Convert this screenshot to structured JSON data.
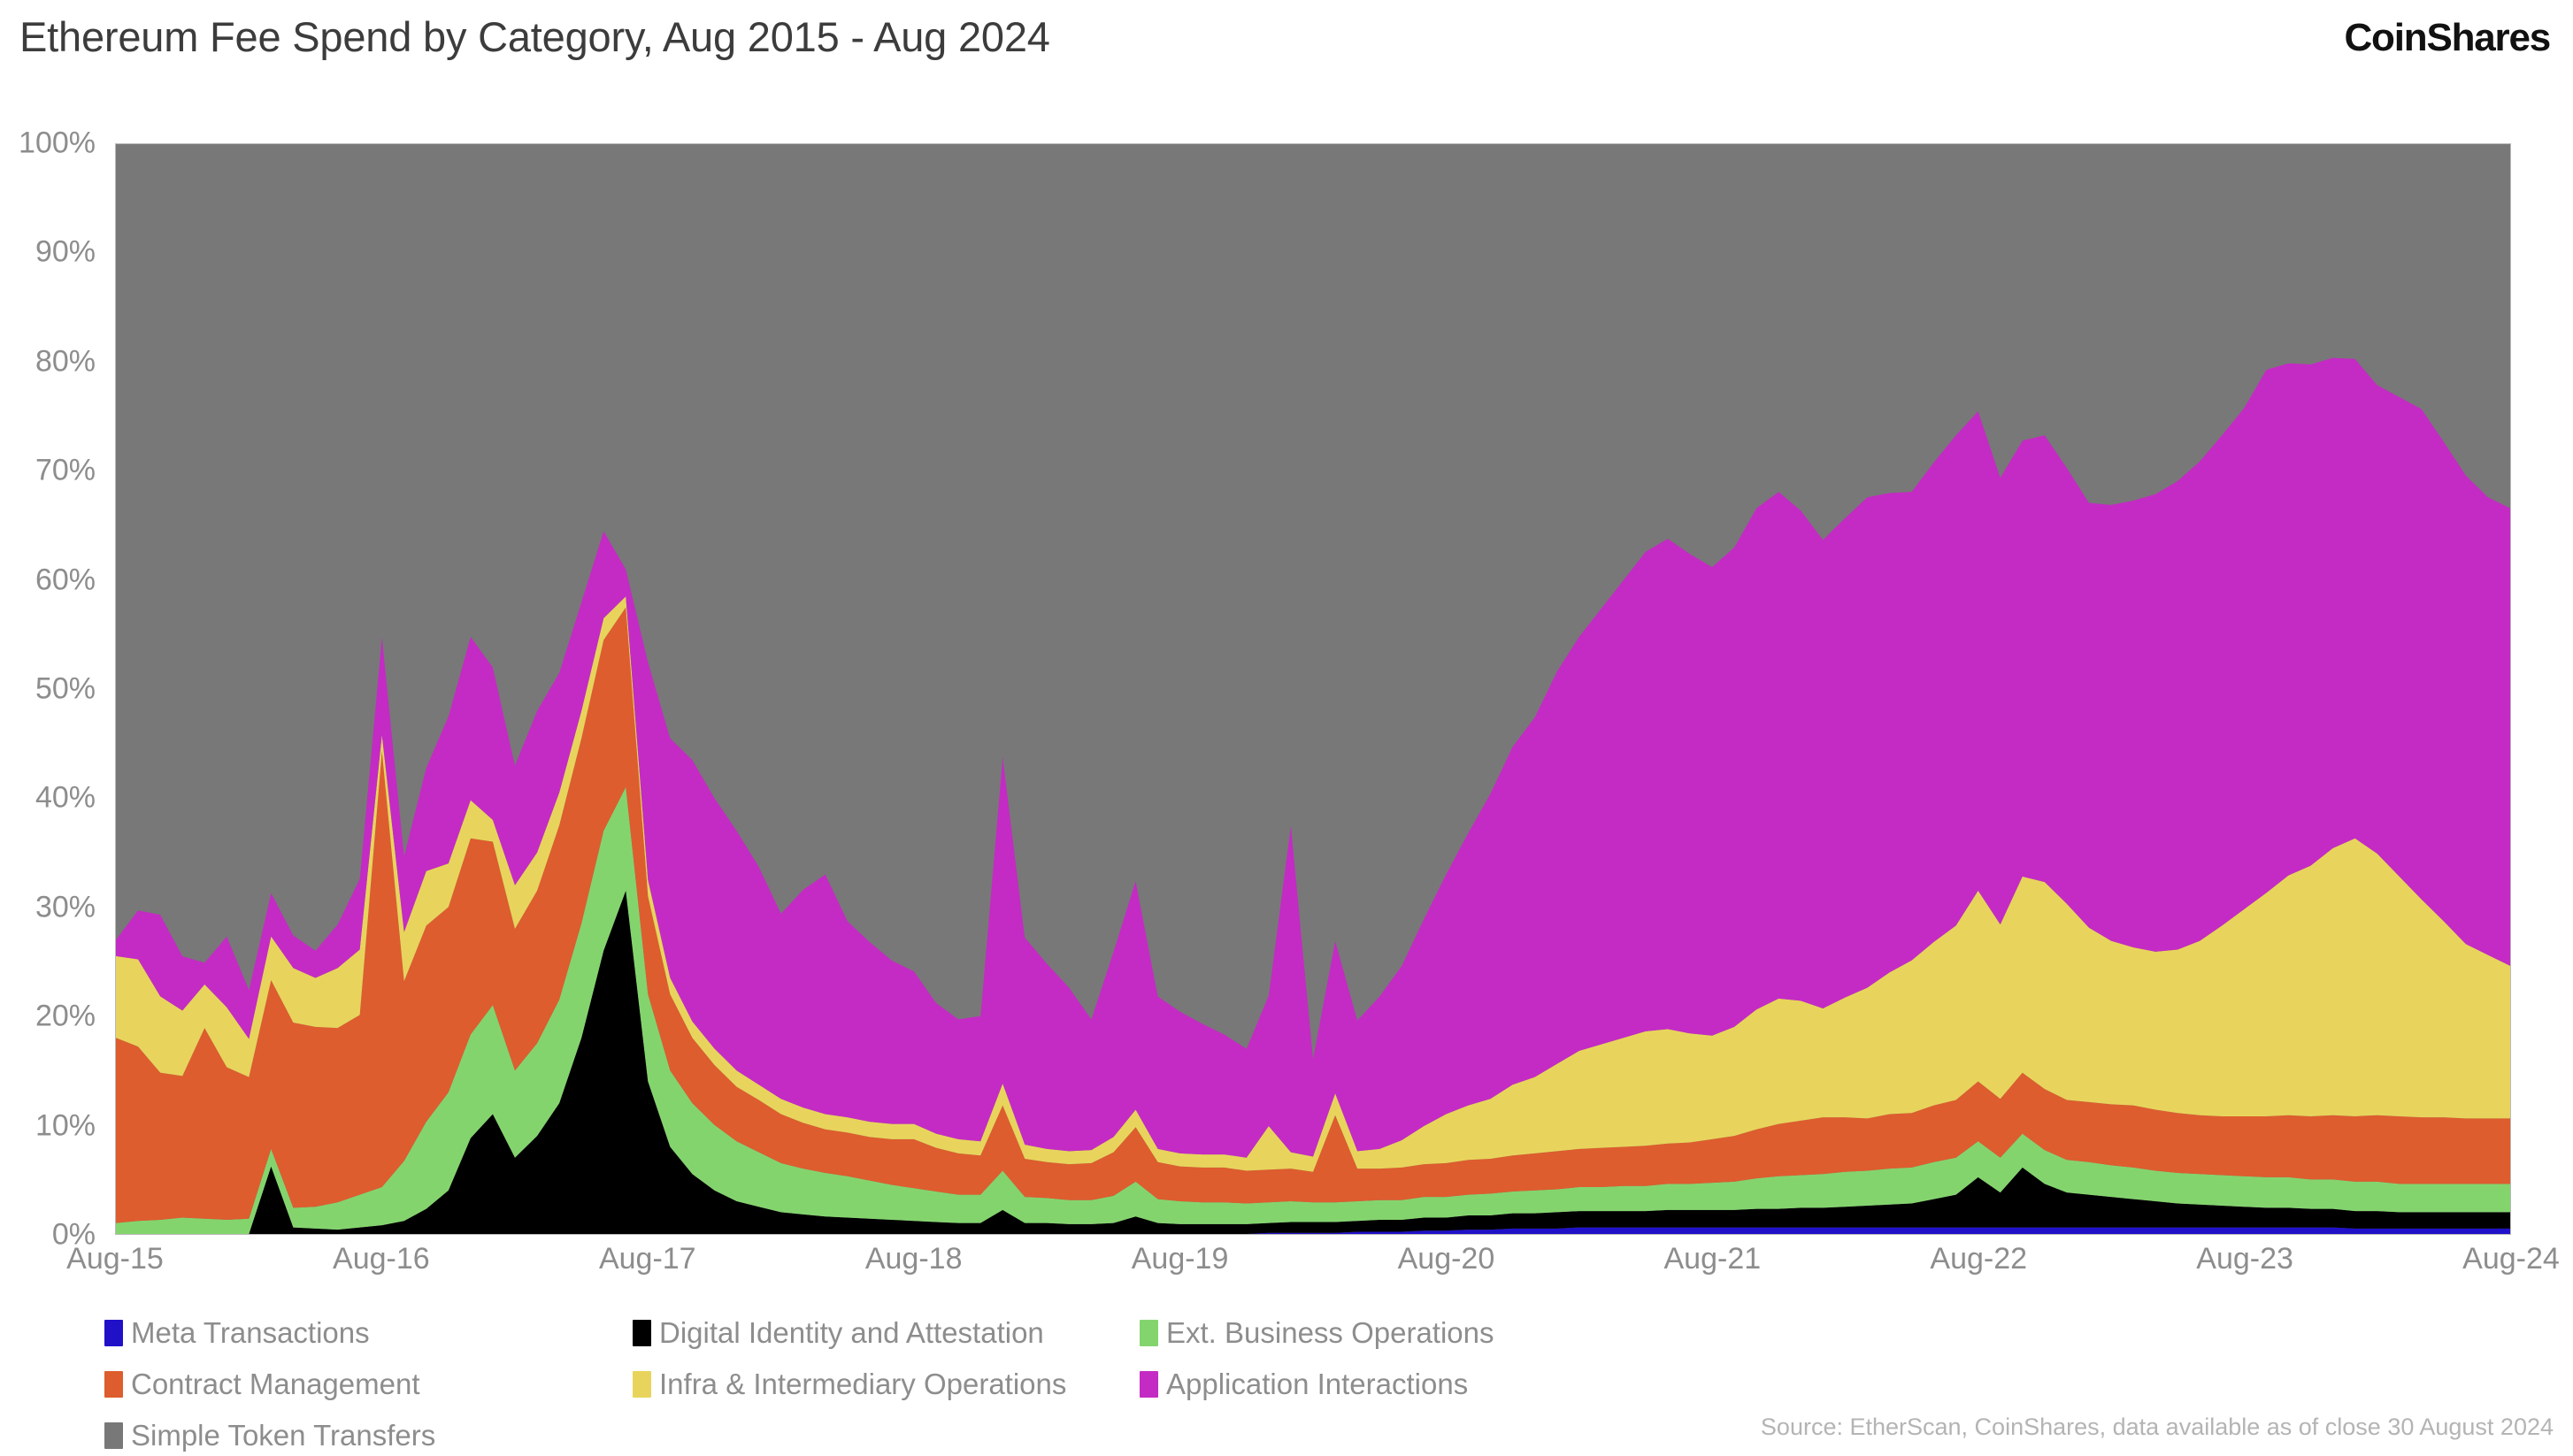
{
  "header": {
    "title": "Ethereum Fee Spend by Category, Aug 2015 - Aug 2024",
    "brand": "CoinShares"
  },
  "source": {
    "text": "Source: EtherScan, CoinShares, data available as of close 30 August 2024"
  },
  "legend": {
    "items": [
      {
        "label": "Meta Transactions",
        "color": "#2011c9",
        "col": 1,
        "row": 1
      },
      {
        "label": "Digital Identity and Attestation",
        "color": "#000000",
        "col": 2,
        "row": 1
      },
      {
        "label": "Ext. Business Operations",
        "color": "#84d46e",
        "col": 3,
        "row": 1
      },
      {
        "label": "Contract Management",
        "color": "#dd5d2e",
        "col": 1,
        "row": 2
      },
      {
        "label": "Infra & Intermediary Operations",
        "color": "#e8d45c",
        "col": 2,
        "row": 2
      },
      {
        "label": "Application Interactions",
        "color": "#c42bc4",
        "col": 3,
        "row": 2
      },
      {
        "label": "Simple Token Transfers",
        "color": "#787878",
        "col": 1,
        "row": 3
      }
    ]
  },
  "chart_data": {
    "type": "area",
    "stacked": true,
    "normalized": true,
    "title": "Ethereum Fee Spend by Category, Aug 2015 - Aug 2024",
    "xlabel": "",
    "ylabel": "",
    "ylim": [
      0,
      100
    ],
    "ytick_labels": [
      "100%",
      "90%",
      "80%",
      "70%",
      "60%",
      "50%",
      "40%",
      "30%",
      "20%",
      "10%",
      "0%"
    ],
    "ytick_values": [
      100,
      90,
      80,
      70,
      60,
      50,
      40,
      30,
      20,
      10,
      0
    ],
    "xtick_labels": [
      "Aug-15",
      "Aug-16",
      "Aug-17",
      "Aug-18",
      "Aug-19",
      "Aug-20",
      "Aug-21",
      "Aug-22",
      "Aug-23",
      "Aug-24"
    ],
    "grid": false,
    "legend_position": "bottom-left",
    "x_start": "Aug-15",
    "x_end": "Aug-24",
    "x_step_months": 1,
    "n_points": 109,
    "series": [
      {
        "name": "Meta Transactions",
        "color": "#2011c9",
        "values": [
          0,
          0,
          0,
          0,
          0,
          0,
          0,
          0,
          0,
          0,
          0,
          0,
          0,
          0,
          0,
          0,
          0,
          0,
          0,
          0,
          0,
          0,
          0,
          0,
          0,
          0,
          0,
          0,
          0,
          0,
          0,
          0,
          0,
          0,
          0,
          0,
          0,
          0,
          0,
          0,
          0,
          0,
          0,
          0,
          0,
          0,
          0,
          0,
          0,
          0,
          0,
          0,
          0.1,
          0.1,
          0.1,
          0.1,
          0.2,
          0.2,
          0.2,
          0.3,
          0.3,
          0.4,
          0.4,
          0.5,
          0.5,
          0.5,
          0.6,
          0.6,
          0.6,
          0.6,
          0.6,
          0.6,
          0.6,
          0.6,
          0.6,
          0.6,
          0.6,
          0.6,
          0.6,
          0.6,
          0.6,
          0.6,
          0.6,
          0.6,
          0.6,
          0.6,
          0.6,
          0.6,
          0.6,
          0.6,
          0.6,
          0.6,
          0.6,
          0.6,
          0.6,
          0.6,
          0.6,
          0.6,
          0.6,
          0.6,
          0.6,
          0.5,
          0.5,
          0.5,
          0.5,
          0.5,
          0.5,
          0.5,
          0.5
        ]
      },
      {
        "name": "Digital Identity and Attestation",
        "color": "#000000",
        "values": [
          0,
          0,
          0,
          0,
          0,
          0,
          0,
          6.2,
          0.6,
          0.5,
          0.4,
          0.6,
          0.8,
          1.2,
          2.3,
          4.0,
          8.8,
          11.0,
          7.0,
          9.0,
          12.0,
          18.0,
          26.0,
          31.5,
          14.0,
          8.0,
          5.5,
          4.0,
          3.0,
          2.5,
          2.0,
          1.8,
          1.6,
          1.5,
          1.4,
          1.3,
          1.2,
          1.1,
          1.0,
          1.0,
          2.2,
          1.0,
          1.0,
          0.9,
          0.9,
          1.0,
          1.6,
          1.0,
          0.9,
          0.9,
          0.9,
          0.9,
          0.9,
          1.0,
          1.0,
          1.0,
          1.0,
          1.1,
          1.1,
          1.2,
          1.2,
          1.3,
          1.3,
          1.4,
          1.4,
          1.5,
          1.5,
          1.5,
          1.5,
          1.5,
          1.6,
          1.6,
          1.6,
          1.6,
          1.7,
          1.7,
          1.8,
          1.8,
          1.9,
          2.0,
          2.1,
          2.2,
          2.6,
          3.0,
          4.6,
          3.2,
          5.5,
          4.0,
          3.2,
          3.0,
          2.8,
          2.6,
          2.4,
          2.2,
          2.1,
          2.0,
          1.9,
          1.8,
          1.8,
          1.7,
          1.7,
          1.6,
          1.6,
          1.5,
          1.5,
          1.5,
          1.5,
          1.5,
          1.5
        ]
      },
      {
        "name": "Ext. Business Operations",
        "color": "#84d46e",
        "values": [
          1.0,
          1.2,
          1.3,
          1.5,
          1.4,
          1.3,
          1.4,
          1.6,
          1.8,
          2.0,
          2.5,
          3.0,
          3.5,
          5.5,
          8.0,
          9.0,
          9.5,
          10.0,
          8.0,
          8.5,
          9.5,
          10.5,
          11.0,
          9.5,
          8.0,
          7.0,
          6.5,
          6.0,
          5.5,
          5.0,
          4.5,
          4.2,
          4.0,
          3.8,
          3.5,
          3.2,
          3.0,
          2.8,
          2.6,
          2.6,
          3.6,
          2.4,
          2.3,
          2.2,
          2.2,
          2.5,
          3.2,
          2.2,
          2.1,
          2.0,
          2.0,
          1.9,
          1.9,
          1.9,
          1.8,
          1.8,
          1.8,
          1.8,
          1.8,
          1.9,
          1.9,
          1.9,
          2.0,
          2.0,
          2.1,
          2.1,
          2.2,
          2.2,
          2.3,
          2.3,
          2.4,
          2.4,
          2.5,
          2.6,
          2.8,
          3.0,
          3.0,
          3.1,
          3.2,
          3.2,
          3.3,
          3.3,
          3.4,
          3.4,
          3.3,
          3.2,
          3.1,
          3.1,
          3.0,
          3.0,
          2.9,
          2.9,
          2.8,
          2.8,
          2.8,
          2.8,
          2.8,
          2.8,
          2.8,
          2.7,
          2.7,
          2.7,
          2.7,
          2.6,
          2.6,
          2.6,
          2.6,
          2.6,
          2.6
        ]
      },
      {
        "name": "Contract Management",
        "color": "#dd5d2e",
        "values": [
          17.0,
          16.0,
          13.5,
          13.0,
          17.5,
          14.0,
          13.0,
          15.5,
          17.0,
          16.5,
          16.0,
          16.5,
          40.0,
          16.5,
          18.0,
          17.0,
          18.0,
          15.0,
          13.0,
          14.0,
          16.0,
          17.0,
          17.5,
          16.5,
          9.0,
          7.0,
          6.0,
          5.5,
          5.0,
          4.8,
          4.5,
          4.2,
          4.0,
          4.0,
          4.0,
          4.2,
          4.5,
          4.0,
          3.8,
          3.6,
          6.0,
          3.5,
          3.3,
          3.3,
          3.4,
          4.0,
          5.0,
          3.4,
          3.2,
          3.2,
          3.2,
          3.0,
          3.0,
          3.0,
          2.8,
          8.0,
          3.0,
          2.9,
          3.0,
          3.0,
          3.1,
          3.2,
          3.2,
          3.3,
          3.4,
          3.5,
          3.5,
          3.6,
          3.6,
          3.7,
          3.7,
          3.8,
          4.0,
          4.2,
          4.5,
          4.8,
          5.0,
          5.2,
          5.0,
          4.8,
          5.0,
          5.0,
          5.2,
          5.3,
          5.5,
          5.4,
          5.6,
          5.6,
          5.5,
          5.5,
          5.6,
          5.7,
          5.6,
          5.5,
          5.4,
          5.4,
          5.5,
          5.6,
          5.7,
          5.8,
          5.9,
          6.0,
          6.1,
          6.2,
          6.1,
          6.1,
          6.0,
          6.0,
          6.0
        ]
      },
      {
        "name": "Infra & Intermediary Operations",
        "color": "#e8d45c",
        "values": [
          7.5,
          8.0,
          7.0,
          6.0,
          4.0,
          5.5,
          3.5,
          4.0,
          5.0,
          4.5,
          5.5,
          6.0,
          1.5,
          4.5,
          5.0,
          4.0,
          3.5,
          2.0,
          4.0,
          3.5,
          3.0,
          2.5,
          2.0,
          1.0,
          1.5,
          1.5,
          1.5,
          1.5,
          1.5,
          1.4,
          1.4,
          1.4,
          1.4,
          1.4,
          1.4,
          1.4,
          1.4,
          1.3,
          1.3,
          1.3,
          2.0,
          1.3,
          1.2,
          1.2,
          1.2,
          1.4,
          1.6,
          1.2,
          1.2,
          1.2,
          1.2,
          1.2,
          4.0,
          1.5,
          1.4,
          2.0,
          1.6,
          1.8,
          2.5,
          3.5,
          4.5,
          5.0,
          5.5,
          6.5,
          7.0,
          8.0,
          9.0,
          9.5,
          10.0,
          10.5,
          10.5,
          10.0,
          9.5,
          10.0,
          11.0,
          11.5,
          11.0,
          10.0,
          11.0,
          12.0,
          13.0,
          14.0,
          15.0,
          16.0,
          17.5,
          16.0,
          18.0,
          19.0,
          18.0,
          16.0,
          15.0,
          14.5,
          14.5,
          15.0,
          16.0,
          17.5,
          19.0,
          20.5,
          22.0,
          23.0,
          24.5,
          25.5,
          24.0,
          22.0,
          20.0,
          18.0,
          16.0,
          15.0,
          14.0
        ]
      },
      {
        "name": "Application Interactions",
        "color": "#c42bc4",
        "values": [
          1.5,
          4.5,
          7.5,
          5.0,
          2.0,
          6.5,
          4.5,
          4.0,
          3.0,
          2.5,
          4.0,
          6.5,
          9.0,
          7.0,
          9.5,
          13.5,
          15.0,
          14.0,
          11.0,
          13.0,
          11.0,
          10.0,
          8.0,
          2.5,
          20.0,
          22.0,
          24.0,
          23.0,
          22.0,
          20.0,
          17.0,
          20.0,
          22.0,
          18.0,
          16.5,
          15.0,
          14.0,
          12.0,
          11.0,
          11.5,
          30.0,
          19.0,
          17.0,
          15.0,
          12.0,
          17.0,
          21.0,
          14.0,
          13.0,
          12.0,
          11.0,
          10.0,
          12.0,
          30.0,
          9.0,
          14.0,
          12.0,
          14.0,
          16.0,
          19.0,
          22.0,
          25.0,
          28.0,
          31.0,
          33.0,
          36.0,
          38.0,
          40.0,
          42.0,
          44.0,
          45.0,
          44.0,
          43.0,
          44.0,
          46.0,
          46.5,
          45.0,
          43.0,
          44.0,
          45.0,
          44.0,
          43.0,
          44.0,
          45.0,
          44.0,
          41.0,
          40.0,
          41.0,
          40.0,
          39.0,
          40.0,
          41.0,
          42.0,
          43.0,
          44.0,
          45.0,
          46.0,
          48.0,
          47.0,
          46.0,
          45.0,
          44.0,
          43.0,
          44.0,
          45.0,
          44.0,
          43.0,
          42.0,
          42.0
        ]
      },
      {
        "name": "Simple Token Transfers",
        "color": "#787878",
        "values": [
          73.0,
          70.3,
          70.7,
          74.5,
          75.1,
          72.7,
          77.6,
          68.7,
          72.6,
          74.0,
          71.6,
          66.4,
          45.2,
          65.3,
          57.2,
          52.5,
          44.4,
          48.0,
          57.0,
          52.0,
          48.5,
          42.0,
          35.5,
          39.0,
          47.5,
          54.5,
          56.5,
          60.0,
          63.0,
          66.3,
          70.6,
          68.4,
          67.0,
          71.3,
          73.2,
          74.9,
          75.9,
          78.8,
          80.3,
          80.0,
          56.2,
          72.8,
          75.2,
          77.4,
          80.3,
          74.1,
          67.6,
          78.2,
          79.6,
          80.7,
          81.7,
          83.0,
          78.1,
          62.5,
          84.9,
          73.6,
          81.4,
          79.2,
          75.4,
          71.6,
          66.6,
          63.2,
          59.6,
          55.3,
          52.5,
          48.4,
          45.2,
          42.6,
          40.0,
          37.4,
          35.6,
          37.6,
          38.2,
          36.4,
          32.8,
          31.9,
          33.6,
          36.3,
          34.3,
          32.2,
          31.4,
          31.9,
          29.2,
          26.5,
          22.9,
          30.6,
          26.2,
          26.7,
          29.7,
          33.0,
          33.1,
          32.2,
          31.5,
          30.0,
          28.1,
          25.8,
          23.3,
          20.7,
          21.4,
          22.2,
          21.7,
          21.7,
          23.6,
          24.7,
          25.8,
          27.3,
          29.8,
          31.9,
          32.9
        ]
      }
    ]
  }
}
